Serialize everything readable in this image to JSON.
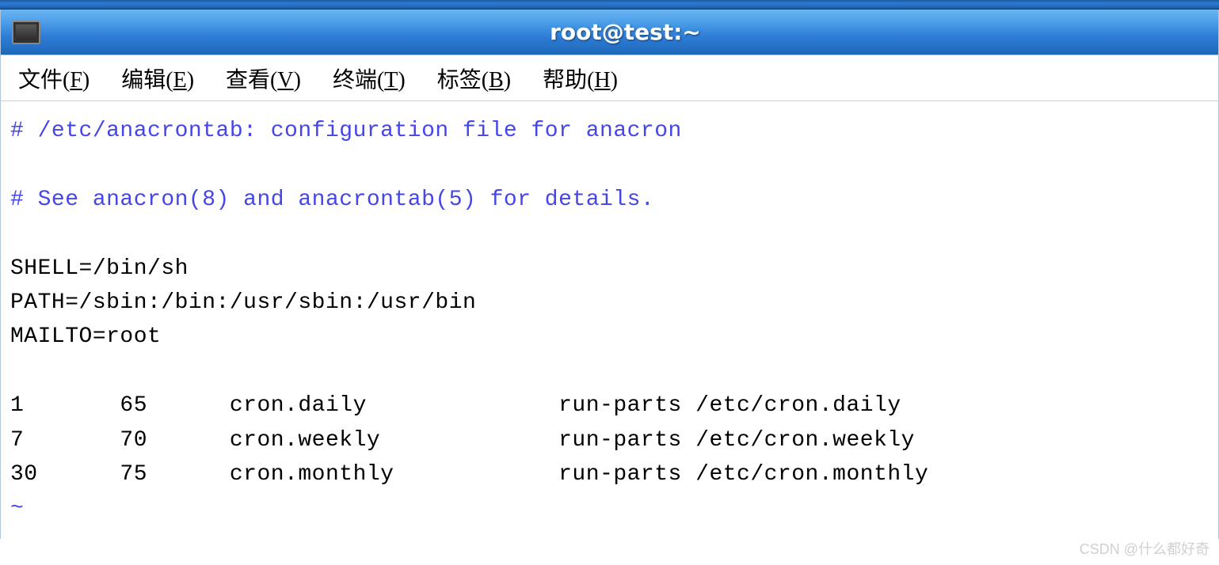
{
  "window": {
    "title": "root@test:~"
  },
  "menubar": {
    "items": [
      {
        "label": "文件",
        "mnemonic": "F"
      },
      {
        "label": "编辑",
        "mnemonic": "E"
      },
      {
        "label": "查看",
        "mnemonic": "V"
      },
      {
        "label": "终端",
        "mnemonic": "T"
      },
      {
        "label": "标签",
        "mnemonic": "B"
      },
      {
        "label": "帮助",
        "mnemonic": "H"
      }
    ]
  },
  "terminal": {
    "lines": {
      "comment1": "# /etc/anacrontab: configuration file for anacron",
      "blank1": "",
      "comment2": "# See anacron(8) and anacrontab(5) for details.",
      "blank2": "",
      "shell": "SHELL=/bin/sh",
      "path": "PATH=/sbin:/bin:/usr/sbin:/usr/bin",
      "mailto": "MAILTO=root",
      "blank3": "",
      "entry1": "1       65      cron.daily              run-parts /etc/cron.daily",
      "entry2": "7       70      cron.weekly             run-parts /etc/cron.weekly",
      "entry3": "30      75      cron.monthly            run-parts /etc/cron.monthly",
      "tilde": "~"
    }
  },
  "watermark": "CSDN @什么都好奇"
}
